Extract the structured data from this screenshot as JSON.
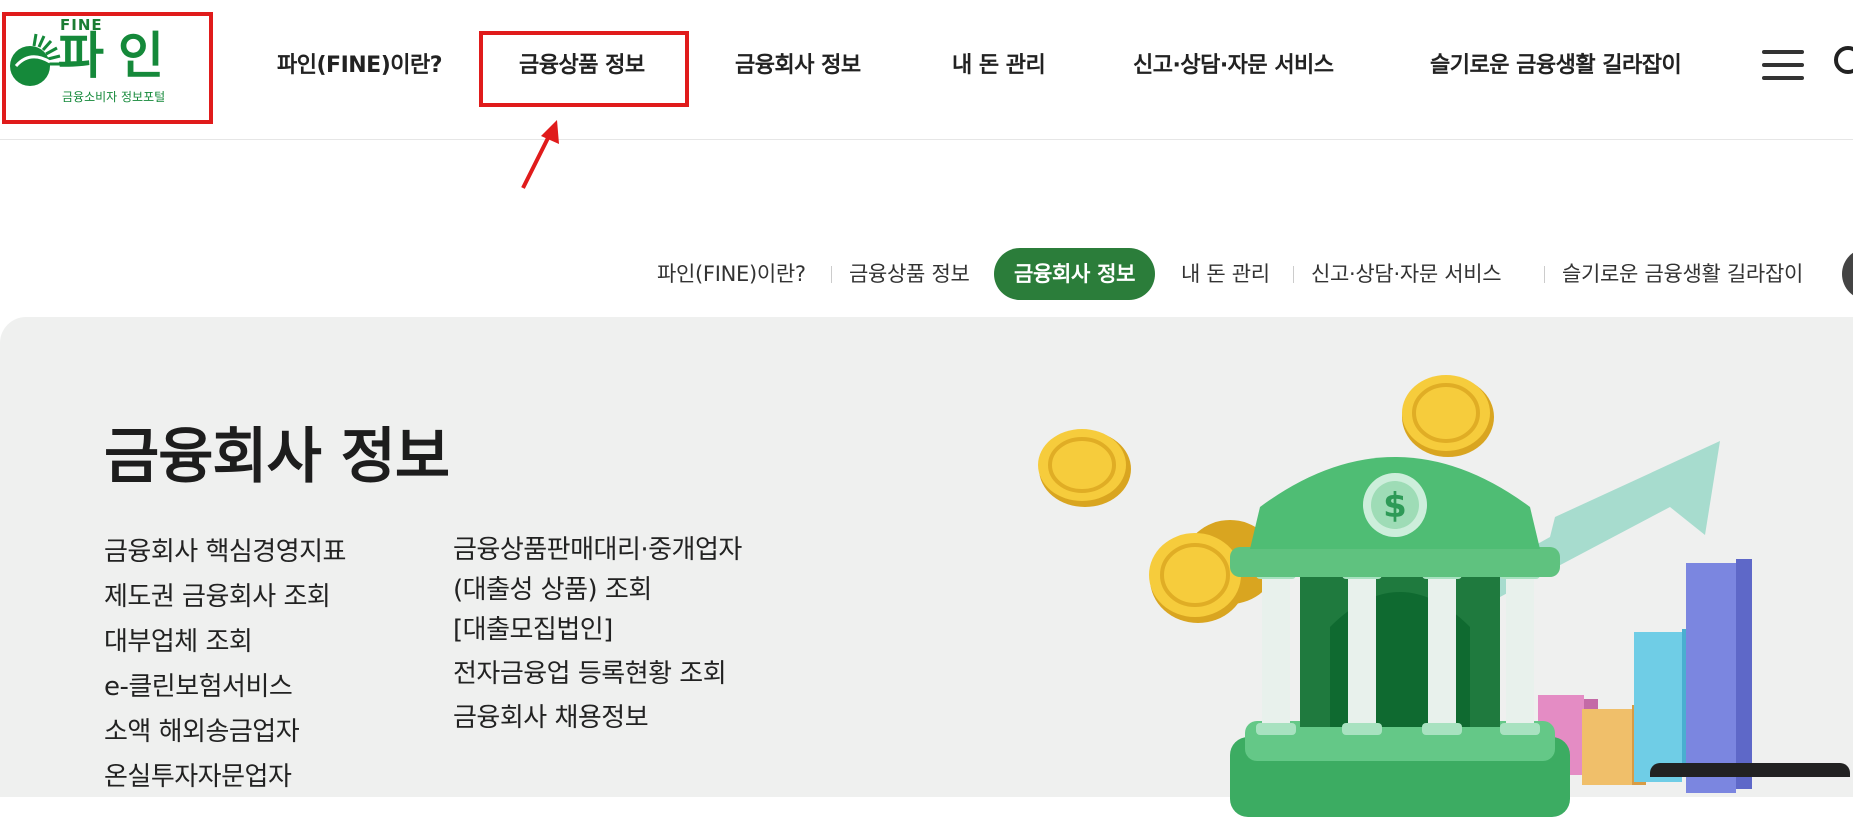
{
  "header": {
    "logo": {
      "fine_text": "FINE",
      "main_text": "파인",
      "sub_text": "금융소비자 정보포털"
    },
    "gnb": [
      {
        "label": "파인(FINE)이란?"
      },
      {
        "label": "금융상품 정보"
      },
      {
        "label": "금융회사 정보"
      },
      {
        "label": "내 돈 관리"
      },
      {
        "label": "신고·상담·자문 서비스"
      },
      {
        "label": "슬기로운 금융생활 길라잡이"
      }
    ],
    "menu_icon": "hamburger-icon",
    "search_icon": "search-icon"
  },
  "annotations": {
    "highlight_color": "#e01b1b",
    "arrow_icon": "red-arrow-icon"
  },
  "subnav": {
    "items": [
      {
        "label": "파인(FINE)이란?",
        "active": false
      },
      {
        "label": "금융상품 정보",
        "active": false
      },
      {
        "label": "금융회사 정보",
        "active": true
      },
      {
        "label": "내 돈 관리",
        "active": false
      },
      {
        "label": "신고·상담·자문 서비스",
        "active": false
      },
      {
        "label": "슬기로운 금융생활 길라잡이",
        "active": false
      }
    ],
    "active_color": "#2b7d3a"
  },
  "hero": {
    "title": "금융회사 정보",
    "col1": [
      "금융회사 핵심경영지표",
      "제도권 금융회사 조회",
      "대부업체 조회",
      "e-클린보험서비스",
      "소액 해외송금업자",
      "온실투자자문업자"
    ],
    "col2": [
      "금융상품판매대리·중개업자",
      "(대출성 상품) 조회",
      "[대출모집법인]",
      "전자금융업 등록현황 조회",
      "금융회사 채용정보"
    ],
    "illustration": "bank-with-coins-and-chart-illustration",
    "background": "#eff0ef"
  }
}
